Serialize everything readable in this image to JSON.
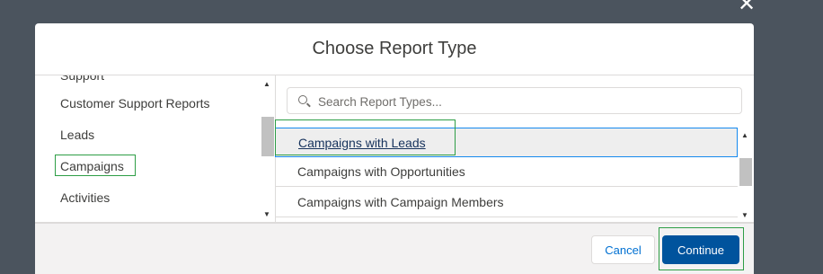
{
  "overlay": {
    "close_glyph": "✕"
  },
  "modal": {
    "title": "Choose Report Type",
    "left_panel": {
      "partial_item": "Support",
      "items": [
        "Customer Support Reports",
        "Leads",
        "Campaigns",
        "Activities"
      ],
      "highlighted": "Campaigns"
    },
    "search": {
      "placeholder": "Search Report Types...",
      "value": ""
    },
    "report_types": [
      "Campaigns with Leads",
      "Campaigns with Opportunities",
      "Campaigns with Campaign Members"
    ],
    "selected_report_type": "Campaigns with Leads",
    "footer": {
      "cancel_label": "Cancel",
      "continue_label": "Continue"
    }
  },
  "colors": {
    "backdrop": "#4b545e",
    "brand_button": "#00539d",
    "highlight_outline": "#2e9e46",
    "selection_outline": "#1589ee"
  }
}
